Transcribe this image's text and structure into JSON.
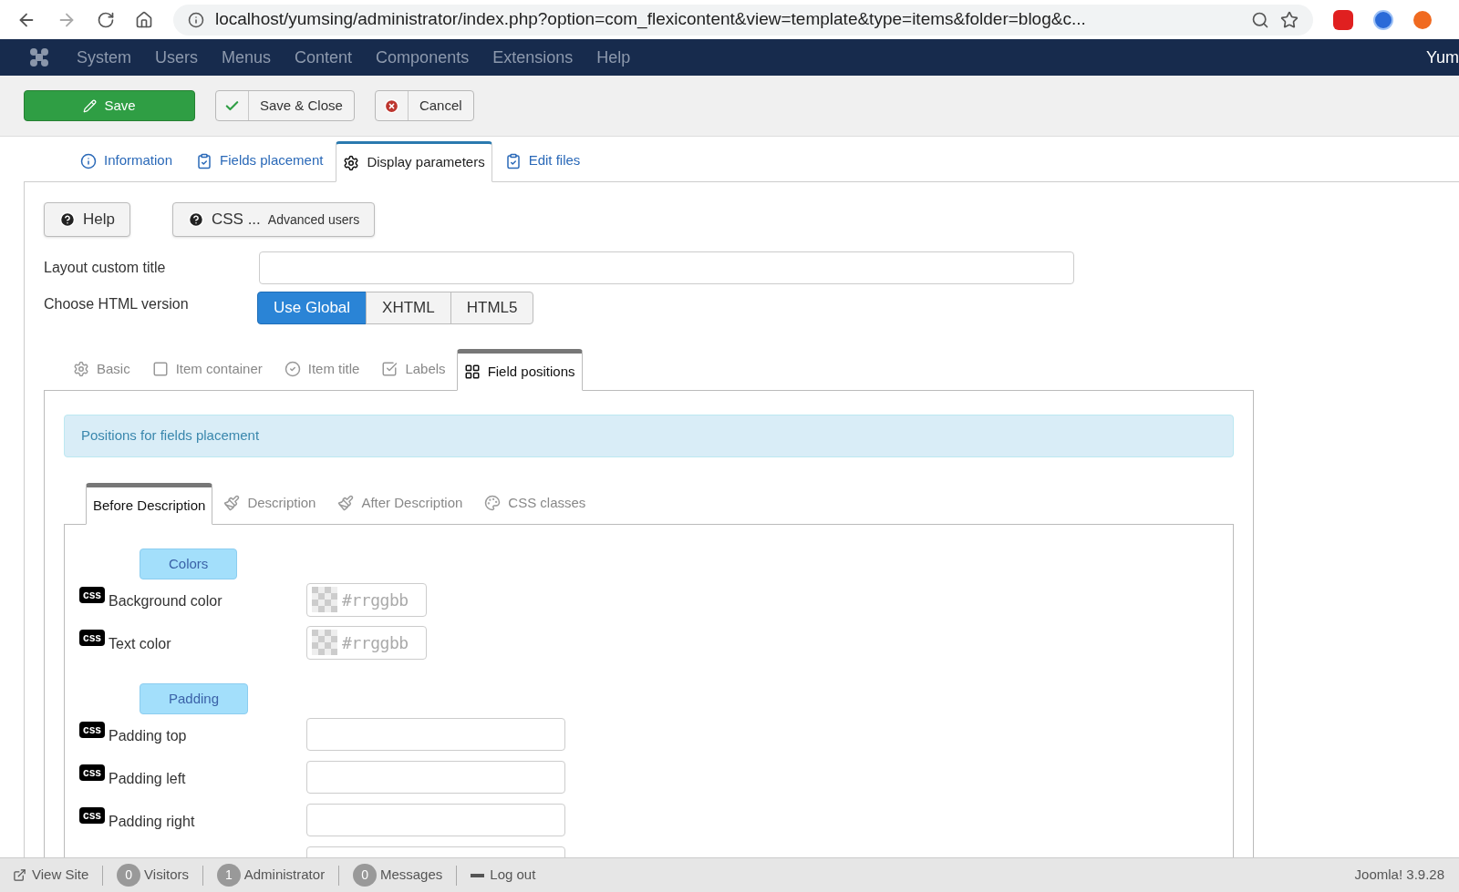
{
  "browser": {
    "url": "localhost/yumsing/administrator/index.php?option=com_flexicontent&view=template&type=items&folder=blog&c..."
  },
  "navbar": {
    "menu": [
      "System",
      "Users",
      "Menus",
      "Content",
      "Components",
      "Extensions",
      "Help"
    ],
    "user": "Yum"
  },
  "toolbar": [
    {
      "label": "Save",
      "kind": "save"
    },
    {
      "label": "Save & Close",
      "kind": "check"
    },
    {
      "label": "Cancel",
      "kind": "cancel"
    }
  ],
  "tabs": [
    {
      "label": "Information",
      "selected": false
    },
    {
      "label": "Fields placement",
      "selected": false
    },
    {
      "label": "Display parameters",
      "selected": true
    },
    {
      "label": "Edit files",
      "selected": false
    }
  ],
  "help_buttons": [
    {
      "label": "Help"
    },
    {
      "label": "CSS ...",
      "sublabel": "Advanced users"
    }
  ],
  "layout_title": {
    "label": "Layout custom title"
  },
  "html_version": {
    "label": "Choose HTML version",
    "options": [
      {
        "label": "Use Global",
        "selected": true
      },
      {
        "label": "XHTML",
        "selected": false
      },
      {
        "label": "HTML5",
        "selected": false
      }
    ]
  },
  "subtabs": [
    {
      "label": "Basic",
      "selected": false
    },
    {
      "label": "Item container",
      "selected": false
    },
    {
      "label": "Item title",
      "selected": false
    },
    {
      "label": "Labels",
      "selected": false
    },
    {
      "label": "Field positions",
      "selected": true
    }
  ],
  "alert": "Positions for fields placement",
  "position_tabs": [
    {
      "label": "Before Description",
      "selected": true
    },
    {
      "label": "Description",
      "selected": false
    },
    {
      "label": "After Description",
      "selected": false
    },
    {
      "label": "CSS classes",
      "selected": false
    }
  ],
  "groups": [
    {
      "heading": "Colors",
      "rows": [
        {
          "badge": "css",
          "label": "Background color",
          "kind": "color",
          "placeholder": "#rrggbb"
        },
        {
          "badge": "css",
          "label": "Text color",
          "kind": "color",
          "placeholder": "#rrggbb"
        }
      ]
    },
    {
      "heading": "Padding",
      "rows": [
        {
          "badge": "css",
          "label": "Padding top",
          "kind": "text"
        },
        {
          "badge": "css",
          "label": "Padding left",
          "kind": "text"
        },
        {
          "badge": "css",
          "label": "Padding right",
          "kind": "text"
        },
        {
          "kind": "text"
        }
      ]
    }
  ],
  "status_bar": {
    "items": [
      {
        "label": "View Site",
        "kind": "link"
      },
      {
        "count": "0",
        "label": "Visitors",
        "kind": "count"
      },
      {
        "count": "1",
        "label": "Administrator",
        "kind": "count"
      },
      {
        "count": "0",
        "label": "Messages",
        "kind": "count"
      },
      {
        "label": "Log out",
        "kind": "logout"
      }
    ],
    "version": "Joomla! 3.9.28"
  }
}
